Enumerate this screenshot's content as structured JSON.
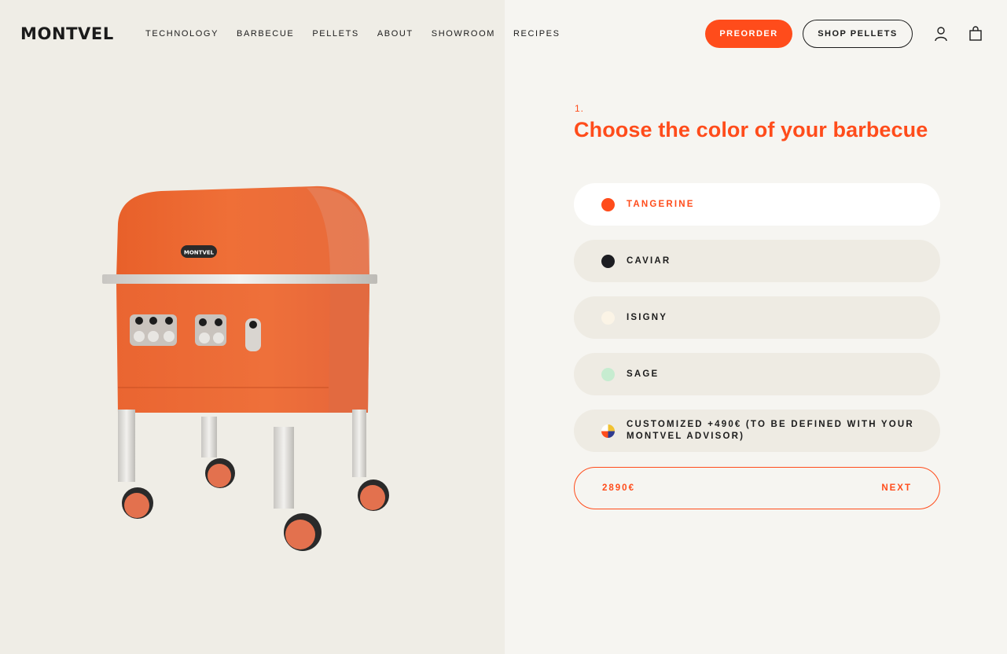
{
  "brand": {
    "logo_text": "MONTVEL",
    "grill_badge": "MONTVEL",
    "accent": "#ff4c1b"
  },
  "nav": {
    "items": [
      "TECHNOLOGY",
      "BARBECUE",
      "PELLETS",
      "ABOUT",
      "SHOWROOM",
      "RECIPES"
    ]
  },
  "header": {
    "preorder_label": "PREORDER",
    "shop_pellets_label": "SHOP PELLETS",
    "icons": [
      "user-icon",
      "shopping-bag-icon"
    ]
  },
  "configurator": {
    "step": "1.",
    "title": "Choose the color of your barbecue",
    "options": [
      {
        "label": "TANGERINE",
        "color": "#ff4c1b",
        "selected": true
      },
      {
        "label": "CAVIAR",
        "color": "#1c1d21",
        "selected": false
      },
      {
        "label": "ISIGNY",
        "color": "#fbf4e6",
        "selected": false
      },
      {
        "label": "SAGE",
        "color": "#c6ecd0",
        "selected": false
      },
      {
        "label": "CUSTOMIZED +490€ (TO BE DEFINED WITH YOUR MONTVEL ADVISOR)",
        "color": "multicolor",
        "selected": false
      }
    ],
    "price": "2890€",
    "next_label": "NEXT"
  }
}
